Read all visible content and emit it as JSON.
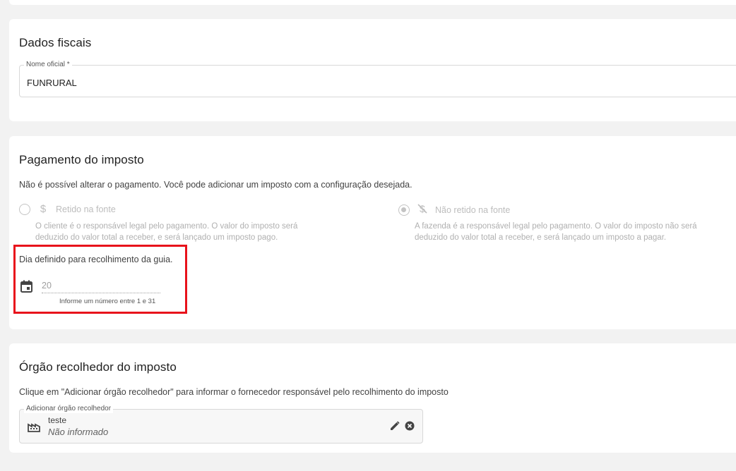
{
  "fiscal": {
    "title": "Dados fiscais",
    "official_name_label": "Nome oficial *",
    "official_name_value": "FUNRURAL"
  },
  "pagamento": {
    "title": "Pagamento do imposto",
    "notice": "Não é possível alterar o pagamento. Você pode adicionar um imposto com a configuração desejada.",
    "options": [
      {
        "label": "Retido na fonte",
        "icon": "dollar-icon",
        "checked": false,
        "desc_line1": "O cliente é o responsável legal pelo pagamento. O valor do imposto será",
        "desc_line2": "deduzido do valor total a receber, e será lançado um imposto pago."
      },
      {
        "label": "Não retido na fonte",
        "icon": "no-dollar-icon",
        "checked": true,
        "desc_line1": "A fazenda é a responsável legal pelo pagamento. O valor do imposto não será",
        "desc_line2": "deduzido do valor total a receber, e será lançado um imposto a pagar."
      }
    ],
    "day_label": "Dia definido para recolhimento da guia.",
    "day_value": "20",
    "day_helper": "Informe um número entre 1 e 31"
  },
  "orgao": {
    "title": "Órgão recolhedor do imposto",
    "instruction": "Clique em \"Adicionar órgão recolhedor\" para informar o fornecedor responsável pelo recolhimento do imposto",
    "field_label": "Adicionar órgão recolhedor",
    "name": "teste",
    "sub": "Não informado"
  },
  "colors": {
    "highlight": "#e8121b",
    "disabled_text": "#bdbdbd"
  }
}
